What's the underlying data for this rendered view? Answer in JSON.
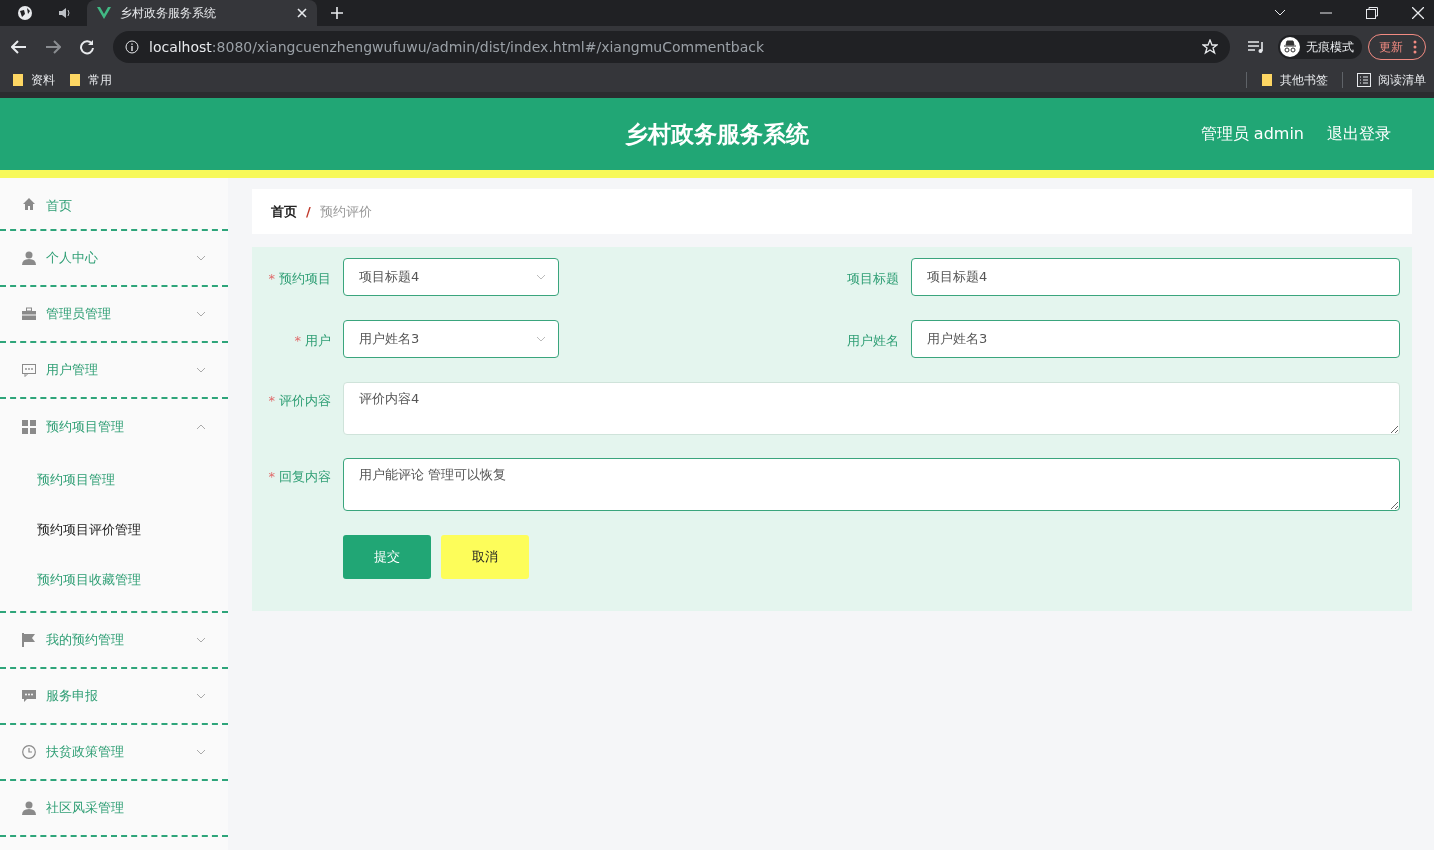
{
  "browser": {
    "tabs": [
      {
        "title": "乡村政务服务系统",
        "selected": true
      }
    ],
    "url": {
      "host": "localhost",
      "path": ":8080/xiangcuenzhengwufuwu/admin/dist/index.html#/xiangmuCommentback"
    },
    "profile": "无痕模式",
    "update_button": "更新",
    "bookmarks": [
      "资料",
      "常用"
    ],
    "bookmarks_right": [
      "其他书签"
    ],
    "reading_list": "阅读清单"
  },
  "header": {
    "title": "乡村政务服务系统",
    "user": "管理员 admin",
    "logout": "退出登录"
  },
  "sidebar": {
    "items": [
      {
        "label": "首页",
        "expandable": false
      },
      {
        "label": "个人中心",
        "expandable": true,
        "expanded": false
      },
      {
        "label": "管理员管理",
        "expandable": true,
        "expanded": false
      },
      {
        "label": "用户管理",
        "expandable": true,
        "expanded": false
      },
      {
        "label": "预约项目管理",
        "expandable": true,
        "expanded": true,
        "children": [
          {
            "label": "预约项目管理",
            "selected": false
          },
          {
            "label": "预约项目评价管理",
            "selected": true
          },
          {
            "label": "预约项目收藏管理",
            "selected": false
          }
        ]
      },
      {
        "label": "我的预约管理",
        "expandable": true,
        "expanded": false
      },
      {
        "label": "服务申报",
        "expandable": true,
        "expanded": false
      },
      {
        "label": "扶贫政策管理",
        "expandable": true,
        "expanded": false
      },
      {
        "label": "社区风采管理",
        "expandable": false
      }
    ]
  },
  "breadcrumb_separator": "/",
  "breadcrumb": [
    {
      "label": "首页",
      "selected": false
    },
    {
      "label": "预约评价",
      "selected": true
    }
  ],
  "form": {
    "required_mark": "*",
    "rows": [
      [
        {
          "kind": "select",
          "label": "预约项目",
          "required": true,
          "value": "项目标题4"
        },
        {
          "kind": "input",
          "label": "项目标题",
          "required": false,
          "value": "项目标题4"
        }
      ],
      [
        {
          "kind": "select",
          "label": "用户",
          "required": true,
          "value": "用户姓名3"
        },
        {
          "kind": "input",
          "label": "用户姓名",
          "required": false,
          "value": "用户姓名3"
        }
      ],
      [
        {
          "kind": "textarea",
          "label": "评价内容",
          "required": true,
          "value": "评价内容4"
        }
      ],
      [
        {
          "kind": "textarea",
          "label": "回复内容",
          "required": true,
          "value": "用户能评论 管理可以恢复"
        }
      ]
    ],
    "buttons": [
      {
        "kind": "primary",
        "label": "提交"
      },
      {
        "kind": "secondary",
        "label": "取消"
      }
    ]
  }
}
